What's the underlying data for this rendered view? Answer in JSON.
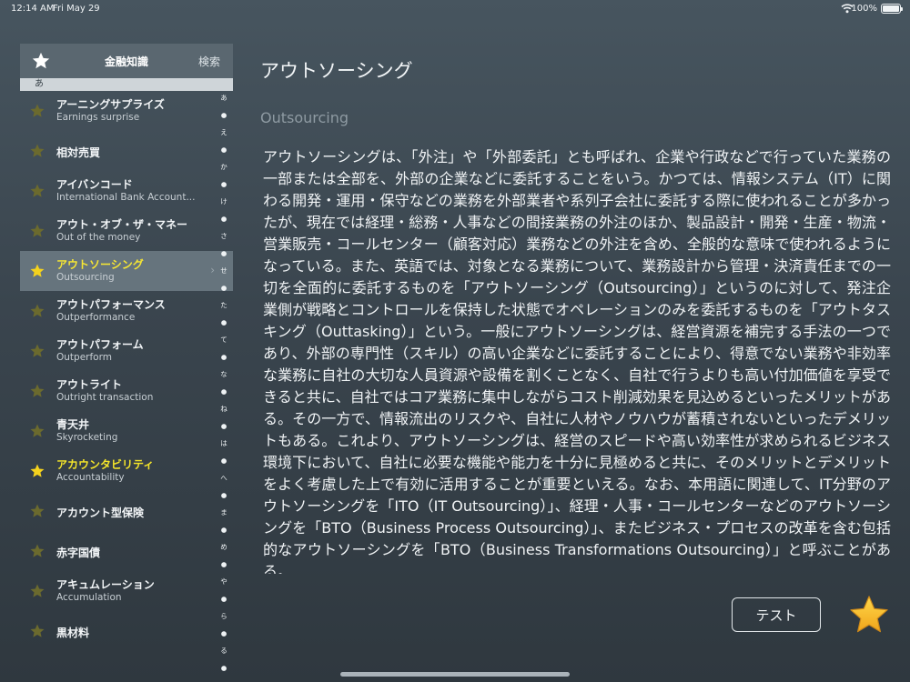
{
  "status_bar": {
    "time": "12:14 AM",
    "date": "Fri May 29",
    "battery": "100%"
  },
  "sidebar": {
    "header": {
      "title": "金融知識",
      "search": "検索"
    },
    "section_label": "あ",
    "items": [
      {
        "term": "アーニングサプライズ",
        "sub": "Earnings surprise",
        "starred": false,
        "selected": false
      },
      {
        "term": "相対売買",
        "sub": "",
        "starred": false,
        "selected": false
      },
      {
        "term": "アイバンコード",
        "sub": "International Bank Account...",
        "starred": false,
        "selected": false
      },
      {
        "term": "アウト・オブ・ザ・マネー",
        "sub": "Out of the money",
        "starred": false,
        "selected": false
      },
      {
        "term": "アウトソーシング",
        "sub": "Outsourcing",
        "starred": true,
        "selected": true
      },
      {
        "term": "アウトパフォーマンス",
        "sub": "Outperformance",
        "starred": false,
        "selected": false
      },
      {
        "term": "アウトパフォーム",
        "sub": "Outperform",
        "starred": false,
        "selected": false
      },
      {
        "term": "アウトライト",
        "sub": "Outright transaction",
        "starred": false,
        "selected": false
      },
      {
        "term": "青天井",
        "sub": "Skyrocketing",
        "starred": false,
        "selected": false
      },
      {
        "term": "アカウンタビリティ",
        "sub": "Accountability",
        "starred": true,
        "selected": false
      },
      {
        "term": "アカウント型保険",
        "sub": "",
        "starred": false,
        "selected": false
      },
      {
        "term": "赤字国債",
        "sub": "",
        "starred": false,
        "selected": false
      },
      {
        "term": "アキュムレーション",
        "sub": "Accumulation",
        "starred": false,
        "selected": false
      },
      {
        "term": "黒材料",
        "sub": "",
        "starred": false,
        "selected": false
      }
    ],
    "index": [
      "あ",
      "●",
      "え",
      "●",
      "か",
      "●",
      "け",
      "●",
      "さ",
      "●",
      "せ",
      "●",
      "た",
      "●",
      "て",
      "●",
      "な",
      "●",
      "ね",
      "●",
      "は",
      "●",
      "へ",
      "●",
      "ま",
      "●",
      "め",
      "●",
      "や",
      "●",
      "ら",
      "●",
      "る",
      "●",
      "わ"
    ]
  },
  "main": {
    "title": "アウトソーシング",
    "subtitle": "Outsourcing",
    "body": "アウトソーシングは、「外注」や「外部委託」とも呼ばれ、企業や行政などで行っていた業務の一部または全部を、外部の企業などに委託することをいう。かつては、情報システム（IT）に関わる開発・運用・保守などの業務を外部業者や系列子会社に委託する際に使われることが多かったが、現在では経理・総務・人事などの間接業務の外注のほか、製品設計・開発・生産・物流・営業販売・コールセンター（顧客対応）業務などの外注を含め、全般的な意味で使われるようになっている。また、英語では、対象となる業務について、業務設計から管理・決済責任までの一切を全面的に委託するものを「アウトソーシング（Outsourcing）」というのに対して、発注企業側が戦略とコントロールを保持した状態でオペレーションのみを委託するものを「アウトタスキング（Outtasking）」という。一般にアウトソーシングは、経営資源を補完する手法の一つであり、外部の専門性（スキル）の高い企業などに委託することにより、得意でない業務や非効率な業務に自社の大切な人員資源や設備を割くことなく、自社で行うよりも高い付加価値を享受できると共に、自社ではコア業務に集中しながらコスト削減効果を見込めるといったメリットがある。その一方で、情報流出のリスクや、自社に人材やノウハウが蓄積されないといったデメリットもある。これより、アウトソーシングは、経営のスピードや高い効率性が求められるビジネス環境下において、自社に必要な機能や能力を十分に見極めると共に、そのメリットとデメリットをよく考慮した上で有効に活用することが重要といえる。なお、本用語に関連して、IT分野のアウトソーシングを「ITO（IT Outsourcing）」、経理・人事・コールセンターなどのアウトソーシングを「BTO（Business Process Outsourcing）」、またビジネス・プロセスの改革を含む包括的なアウトソーシングを「BTO（Business Transformations Outsourcing）」と呼ぶことがある。",
    "test_button": "テスト"
  },
  "colors": {
    "accent_yellow": "#f7e733",
    "star_gold": "#f3b31b",
    "star_dim": "#6b6a2e"
  }
}
